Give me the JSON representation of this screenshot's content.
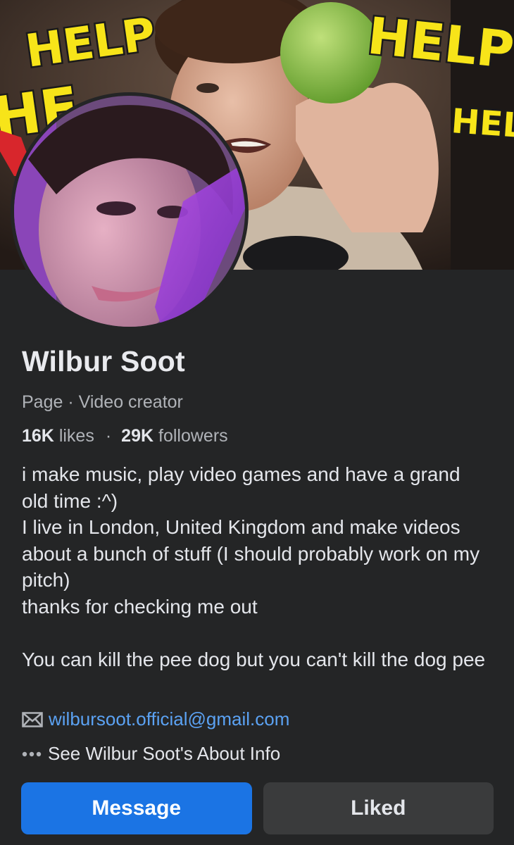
{
  "cover": {
    "help_texts": [
      "HELP",
      "HELP",
      "HE",
      "HELP"
    ]
  },
  "profile": {
    "name": "Wilbur Soot",
    "category_prefix": "Page",
    "category_sep": "·",
    "category": "Video creator",
    "likes_count": "16K",
    "likes_label": "likes",
    "stats_sep": "·",
    "followers_count": "29K",
    "followers_label": "followers",
    "bio": "i make music, play video games and have a grand old time :^)\nI live in London, United Kingdom and make videos about a bunch of stuff (I should probably work on my pitch)\nthanks for checking me out\n\nYou can kill the pee dog but you can't kill the dog pee",
    "email": "wilbursoot.official@gmail.com",
    "about_link": "See Wilbur Soot's About Info"
  },
  "actions": {
    "message_label": "Message",
    "liked_label": "Liked"
  },
  "icons": {
    "email": "envelope-icon",
    "about": "more-dots-icon"
  },
  "colors": {
    "background": "#242526",
    "primary_button": "#1b74e4",
    "secondary_button": "#3a3b3c",
    "link": "#5ba2f3",
    "help_yellow": "#f7e419"
  }
}
